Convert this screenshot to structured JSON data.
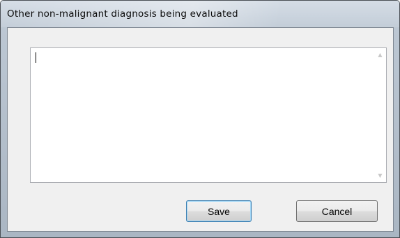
{
  "window": {
    "title": "Other non-malignant diagnosis being evaluated"
  },
  "editor": {
    "value": "",
    "scroll_up_glyph": "▲",
    "scroll_down_glyph": "▼"
  },
  "buttons": {
    "save_label": "Save",
    "cancel_label": "Cancel"
  },
  "colors": {
    "title_bar": "#c3cdd8",
    "client_bg": "#f0f0f0",
    "default_button_border": "#3c7fb1"
  }
}
